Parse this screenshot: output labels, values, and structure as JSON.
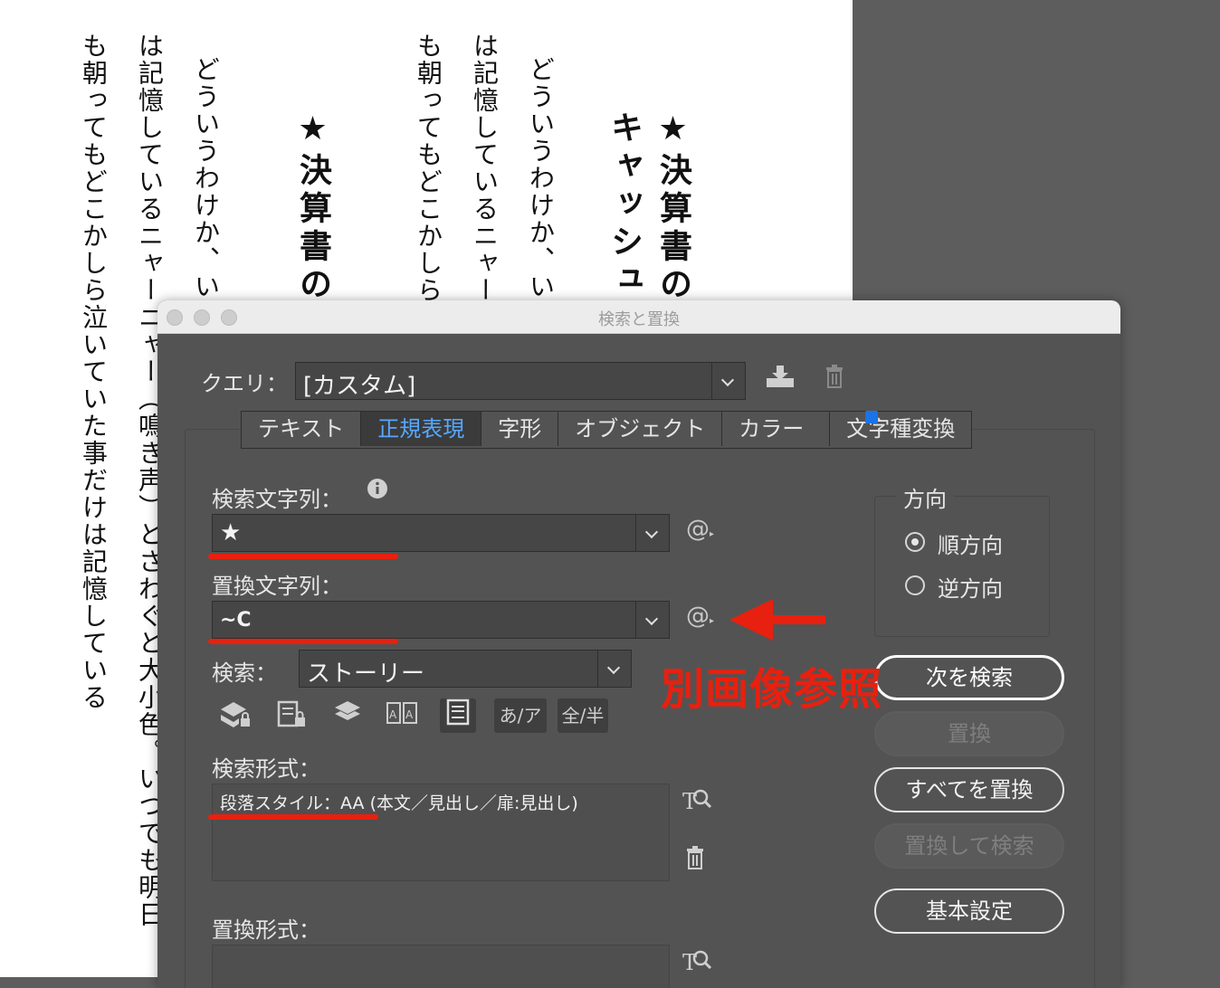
{
  "document": {
    "columns": [
      "も朝ってもどこかしら泣いていた事だけは記憶している",
      "は記憶しているニャーニャー（鳴き声）とさわぐと大小色。いつでも明日",
      "どういうわけか、い",
      "★決算書の",
      "も朝ってもどこかしら",
      "は記憶しているニャー",
      "どういうわけか、い",
      "キャッシュ",
      "★決算書の"
    ]
  },
  "dialog": {
    "title": "検索と置換",
    "query_label": "クエリ：",
    "query_value": "[カスタム]",
    "tabs": [
      "テキスト",
      "正規表現",
      "字形",
      "オブジェクト",
      "カラー",
      "文字種変換"
    ],
    "find_label": "検索文字列：",
    "find_value": "★",
    "replace_label": "置換文字列：",
    "replace_value": "~C",
    "search_label": "検索：",
    "search_scope": "ストーリー",
    "option_icons": [
      "lock-layers-icon",
      "locked-stories-icon",
      "hidden-layers-icon",
      "master-pages-icon",
      "footnotes-icon",
      "あ/ア",
      "全/半"
    ],
    "find_format_label": "検索形式：",
    "find_format_value": "段落スタイル：AA (本文／見出し／扉:見出し)",
    "change_format_label": "置換形式：",
    "direction_label": "方向",
    "direction_forward": "順方向",
    "direction_backward": "逆方向",
    "buttons": {
      "find_next": "次を検索",
      "change": "置換",
      "change_all": "すべてを置換",
      "change_find": "置換して検索",
      "fewer_options": "基本設定"
    },
    "special_char_symbol": "@"
  },
  "annotation": {
    "text": "別画像参照",
    "color": "#e8200f"
  },
  "colors": {
    "panel_bg": "#535353",
    "active_tab_text": "#57a7ff",
    "highlight_red": "#e8200f"
  }
}
